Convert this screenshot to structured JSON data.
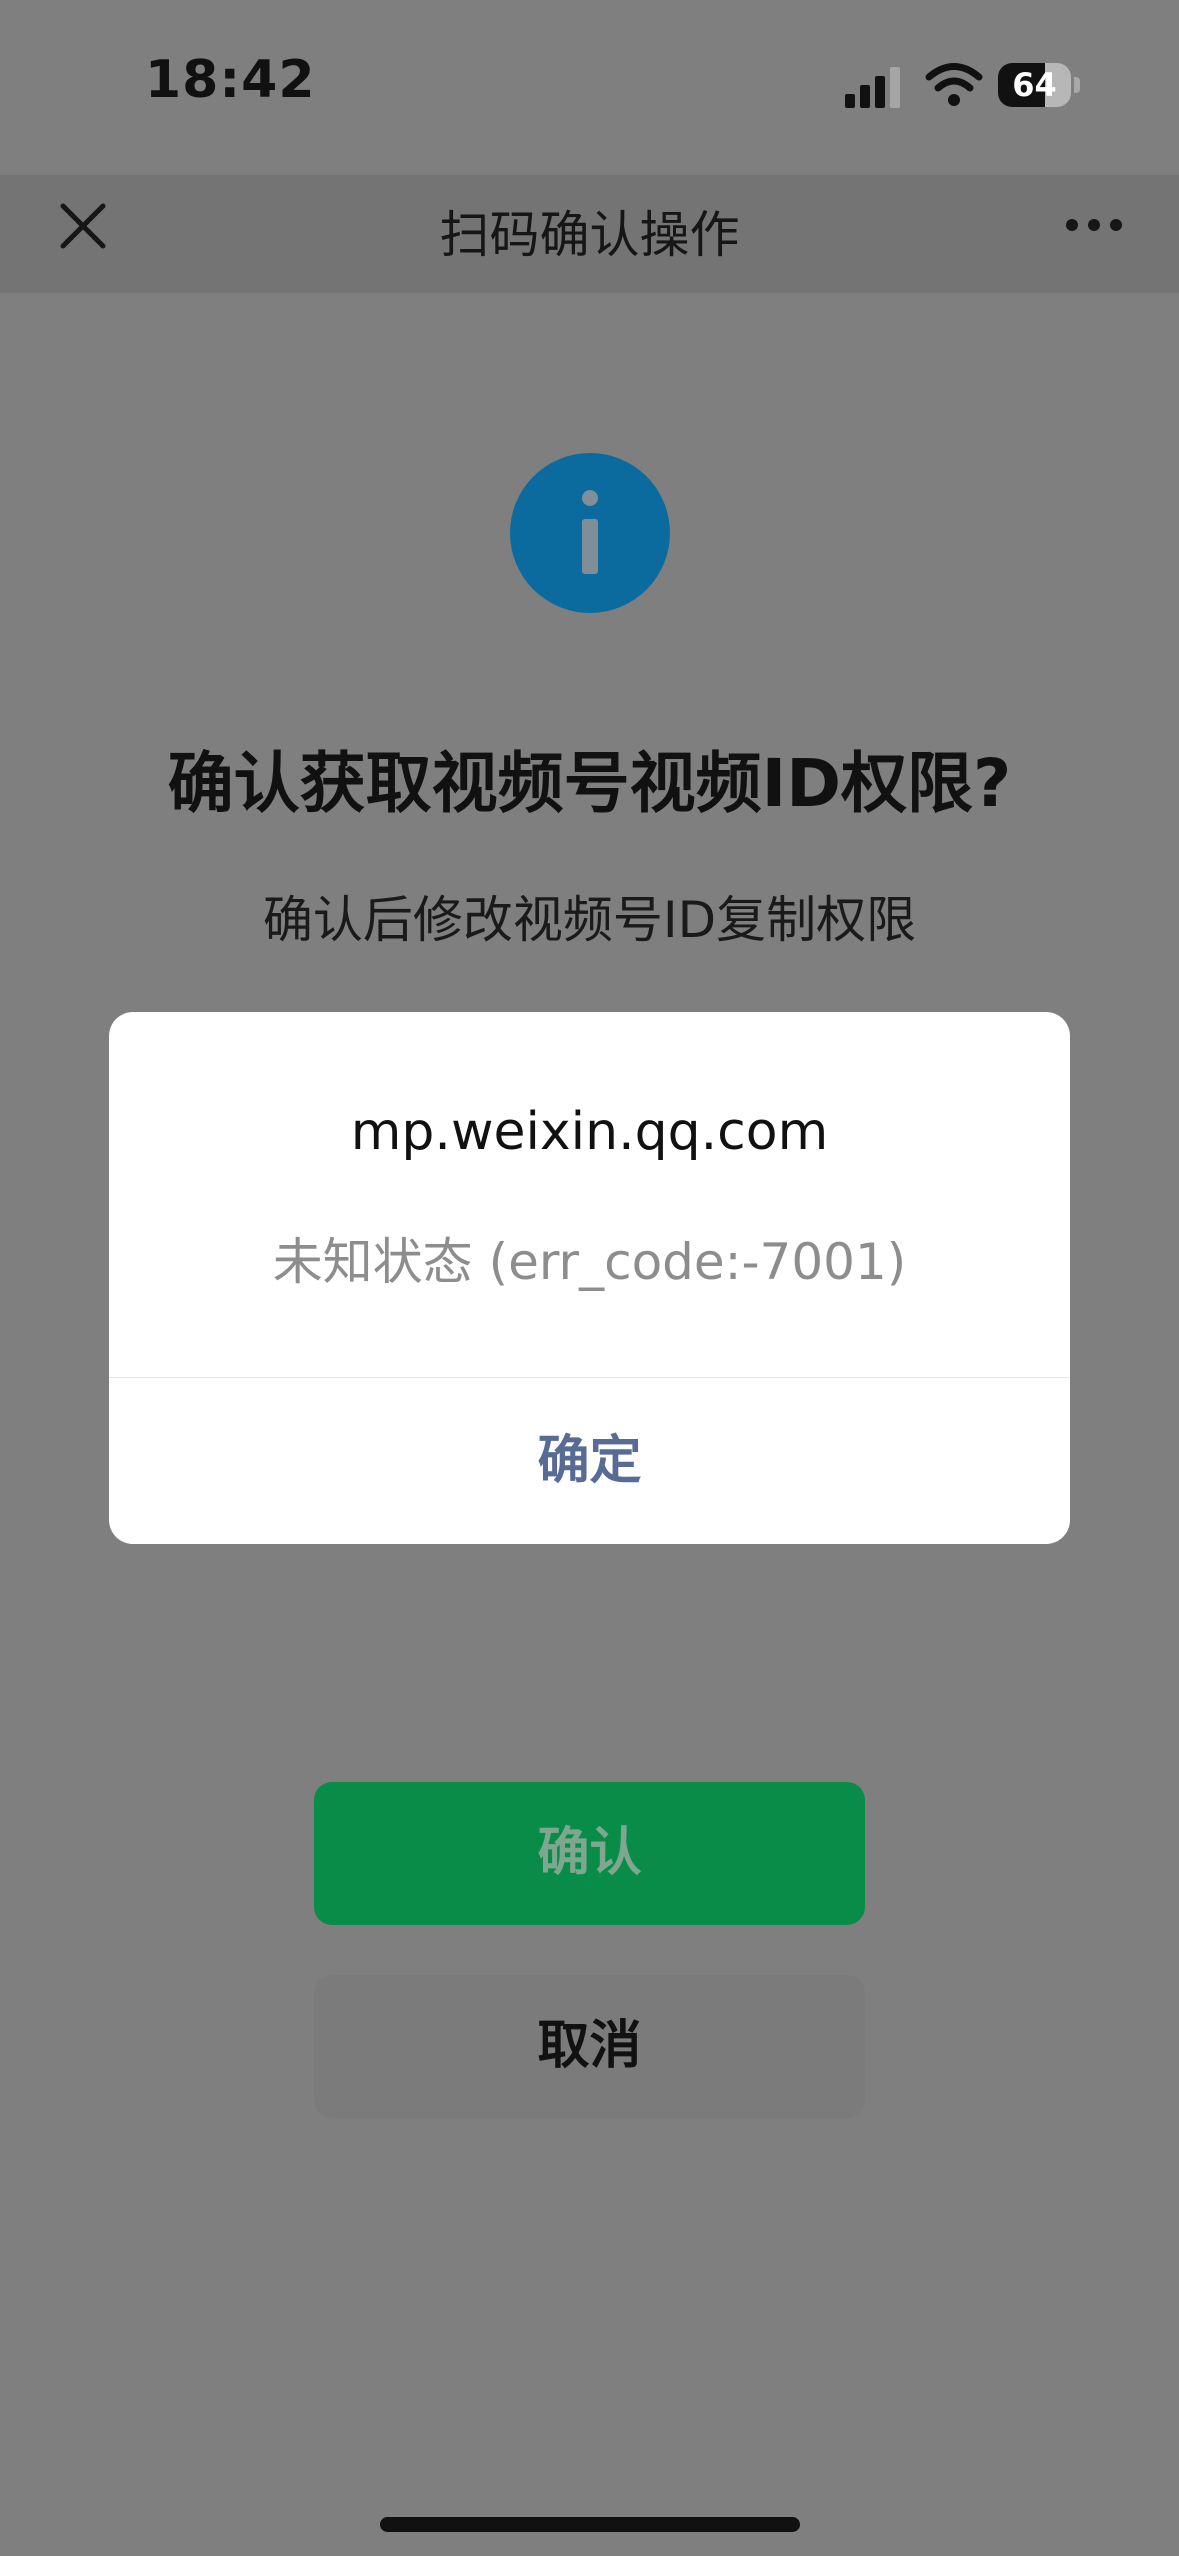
{
  "status_bar": {
    "time": "18:42",
    "battery_level": 64,
    "battery_text": "64",
    "signal_icon": "signal-bars-icon",
    "wifi_icon": "wifi-icon",
    "battery_icon": "battery-icon"
  },
  "nav": {
    "title": "扫码确认操作",
    "close_icon": "close-icon",
    "more_icon": "more-icon"
  },
  "content": {
    "info_icon": "info-icon",
    "title": "确认获取视频号视频ID权限?",
    "description": "确认后修改视频号ID复制权限"
  },
  "actions": {
    "confirm_label": "确认",
    "cancel_label": "取消"
  },
  "dialog": {
    "title": "mp.weixin.qq.com",
    "message": "未知状态 (err_code:-7001)",
    "ok_label": "确定"
  },
  "colors": {
    "overlay_background": "#7f7f7f",
    "primary_button": "#0a8c49",
    "dialog_link": "#576b95",
    "info_icon": "#0b6b9f"
  }
}
